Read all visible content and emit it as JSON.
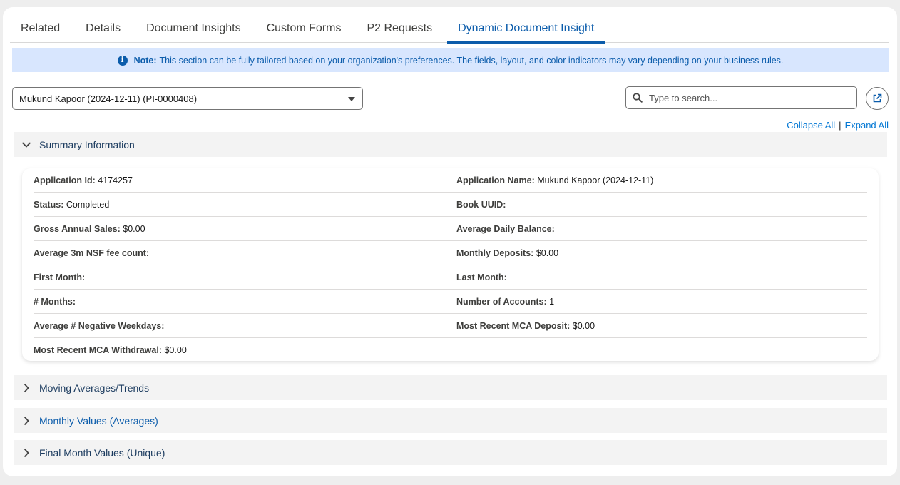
{
  "tabs": [
    {
      "label": "Related",
      "active": false
    },
    {
      "label": "Details",
      "active": false
    },
    {
      "label": "Document Insights",
      "active": false
    },
    {
      "label": "Custom Forms",
      "active": false
    },
    {
      "label": "P2 Requests",
      "active": false
    },
    {
      "label": "Dynamic Document Insight",
      "active": true
    }
  ],
  "note": {
    "icon": "info-icon",
    "label": "Note:",
    "text": "This section can be fully tailored based on your organization's preferences. The fields, layout, and color indicators may vary depending on your business rules."
  },
  "record_select": {
    "value": "Mukund Kapoor (2024-12-11) (PI-0000408)"
  },
  "search": {
    "placeholder": "Type to search..."
  },
  "links": {
    "collapse_all": "Collapse All",
    "separator": "|",
    "expand_all": "Expand All"
  },
  "sections": {
    "summary": {
      "title": "Summary Information",
      "expanded": true
    },
    "moving": {
      "title": "Moving Averages/Trends",
      "expanded": false
    },
    "monthly": {
      "title": "Monthly Values (Averages)",
      "expanded": false
    },
    "final": {
      "title": "Final Month Values (Unique)",
      "expanded": false
    }
  },
  "summary_fields": {
    "application_id": {
      "label": "Application Id:",
      "value": "4174257"
    },
    "application_name": {
      "label": "Application Name:",
      "value": "Mukund Kapoor (2024-12-11)"
    },
    "status": {
      "label": "Status:",
      "value": "Completed"
    },
    "book_uuid": {
      "label": "Book UUID:",
      "value": ""
    },
    "gross_annual_sales": {
      "label": "Gross Annual Sales:",
      "value": "$0.00"
    },
    "average_daily_balance": {
      "label": "Average Daily Balance:",
      "value": ""
    },
    "avg_3m_nsf": {
      "label": "Average 3m NSF fee count:",
      "value": ""
    },
    "monthly_deposits": {
      "label": "Monthly Deposits:",
      "value": "$0.00"
    },
    "first_month": {
      "label": "First Month:",
      "value": ""
    },
    "last_month": {
      "label": "Last Month:",
      "value": ""
    },
    "months": {
      "label": "# Months:",
      "value": ""
    },
    "number_of_accounts": {
      "label": "Number of Accounts:",
      "value": "1"
    },
    "avg_negative_weekdays": {
      "label": "Average # Negative Weekdays:",
      "value": ""
    },
    "most_recent_mca_deposit": {
      "label": "Most Recent MCA Deposit:",
      "value": "$0.00"
    },
    "most_recent_mca_withdrawal": {
      "label": "Most Recent MCA Withdrawal:",
      "value": "$0.00"
    }
  },
  "colors": {
    "accent": "#0b5cab",
    "note_bg": "#d8e6fe",
    "section_bg": "#f3f3f3"
  }
}
